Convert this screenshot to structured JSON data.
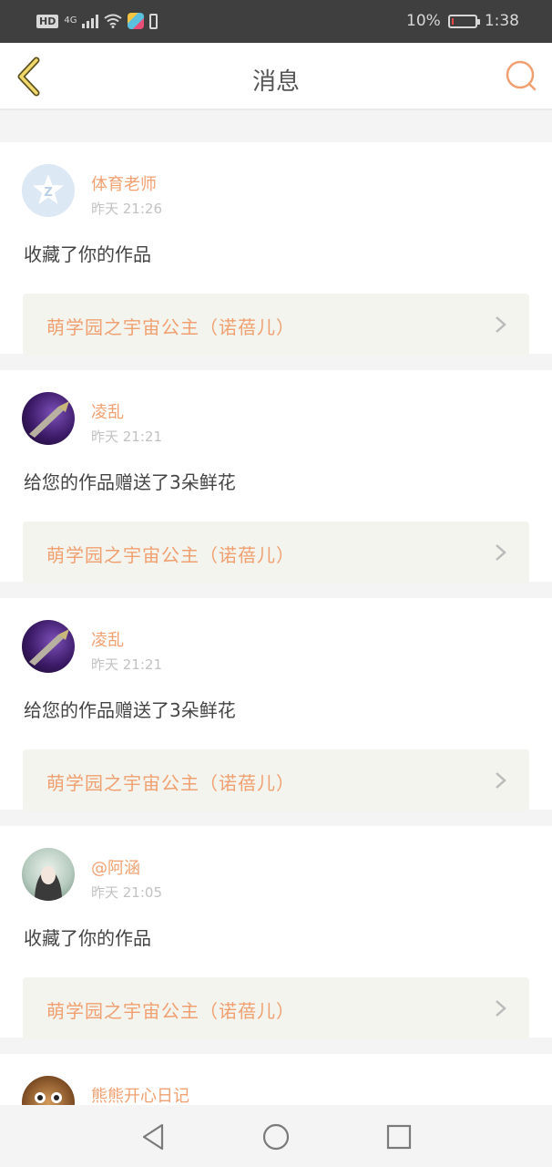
{
  "status_bar": {
    "network_badge": "HD",
    "network_type": "4G",
    "battery_percent": "10%",
    "time": "1:38",
    "battery_level": 0.1,
    "battery_color": "#e84545"
  },
  "header": {
    "title": "消息",
    "back_icon": "chevron-left-icon",
    "search_icon": "search-icon",
    "accent_color": "#f0a070"
  },
  "messages": [
    {
      "user": "体育老师",
      "time": "昨天 21:26",
      "action": "收藏了你的作品",
      "work_title": "萌学园之宇宙公主（诺蓓儿）",
      "avatar": "qq-default-avatar"
    },
    {
      "user": "凌乱",
      "time": "昨天 21:21",
      "action": "给您的作品赠送了3朵鲜花",
      "work_title": "萌学园之宇宙公主（诺蓓儿）",
      "avatar": "sword-avatar"
    },
    {
      "user": "凌乱",
      "time": "昨天 21:21",
      "action": "给您的作品赠送了3朵鲜花",
      "work_title": "萌学园之宇宙公主（诺蓓儿）",
      "avatar": "sword-avatar"
    },
    {
      "user": "@阿涵",
      "time": "昨天 21:05",
      "action": "收藏了你的作品",
      "work_title": "萌学园之宇宙公主（诺蓓儿）",
      "avatar": "girl-avatar"
    },
    {
      "user": "熊熊开心日记",
      "avatar": "bear-avatar"
    }
  ],
  "system_nav": {
    "back_icon": "triangle-back-icon",
    "home_icon": "circle-home-icon",
    "recents_icon": "square-recents-icon"
  }
}
